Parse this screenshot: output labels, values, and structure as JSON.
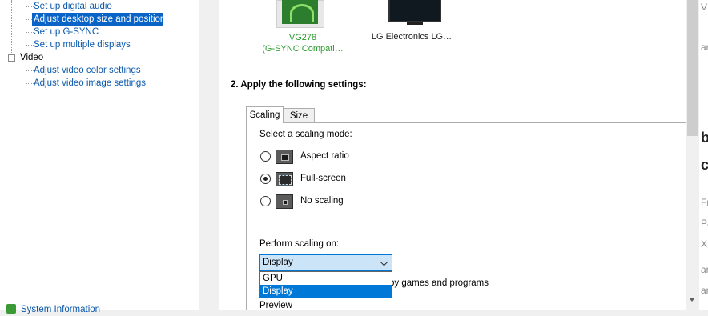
{
  "tree": {
    "items": [
      {
        "label": "Set up digital audio",
        "selected": false
      },
      {
        "label": "Adjust desktop size and position",
        "selected": true
      },
      {
        "label": "Set up G-SYNC",
        "selected": false
      },
      {
        "label": "Set up multiple displays",
        "selected": false
      }
    ],
    "video_category": "Video",
    "video_items": [
      {
        "label": "Adjust video color settings"
      },
      {
        "label": "Adjust video image settings"
      }
    ],
    "system_information": "System Information"
  },
  "displays": [
    {
      "name": "VG278",
      "subtitle": "(G-SYNC Compati…",
      "selected": true
    },
    {
      "name": "LG Electronics LG…",
      "subtitle": "",
      "selected": false
    }
  ],
  "section_heading": "2. Apply the following settings:",
  "tabs": [
    {
      "label": "Scaling",
      "active": true
    },
    {
      "label": "Size",
      "active": false
    }
  ],
  "scaling": {
    "prompt": "Select a scaling mode:",
    "modes": [
      {
        "label": "Aspect ratio",
        "checked": false,
        "icon": "aspect-ratio-icon"
      },
      {
        "label": "Full-screen",
        "checked": true,
        "icon": "full-screen-icon"
      },
      {
        "label": "No scaling",
        "checked": false,
        "icon": "no-scaling-icon"
      }
    ],
    "perform_label": "Perform scaling on:",
    "perform_value": "Display",
    "perform_options": [
      "GPU",
      "Display"
    ],
    "override_text_partial": "by games and programs",
    "preview_label": "Preview"
  },
  "edge_text": [
    "V",
    "",
    "ar",
    "",
    "",
    "",
    "b",
    "c",
    "Fr",
    "Pa",
    "X",
    "ar",
    "",
    "ar",
    "ar"
  ]
}
